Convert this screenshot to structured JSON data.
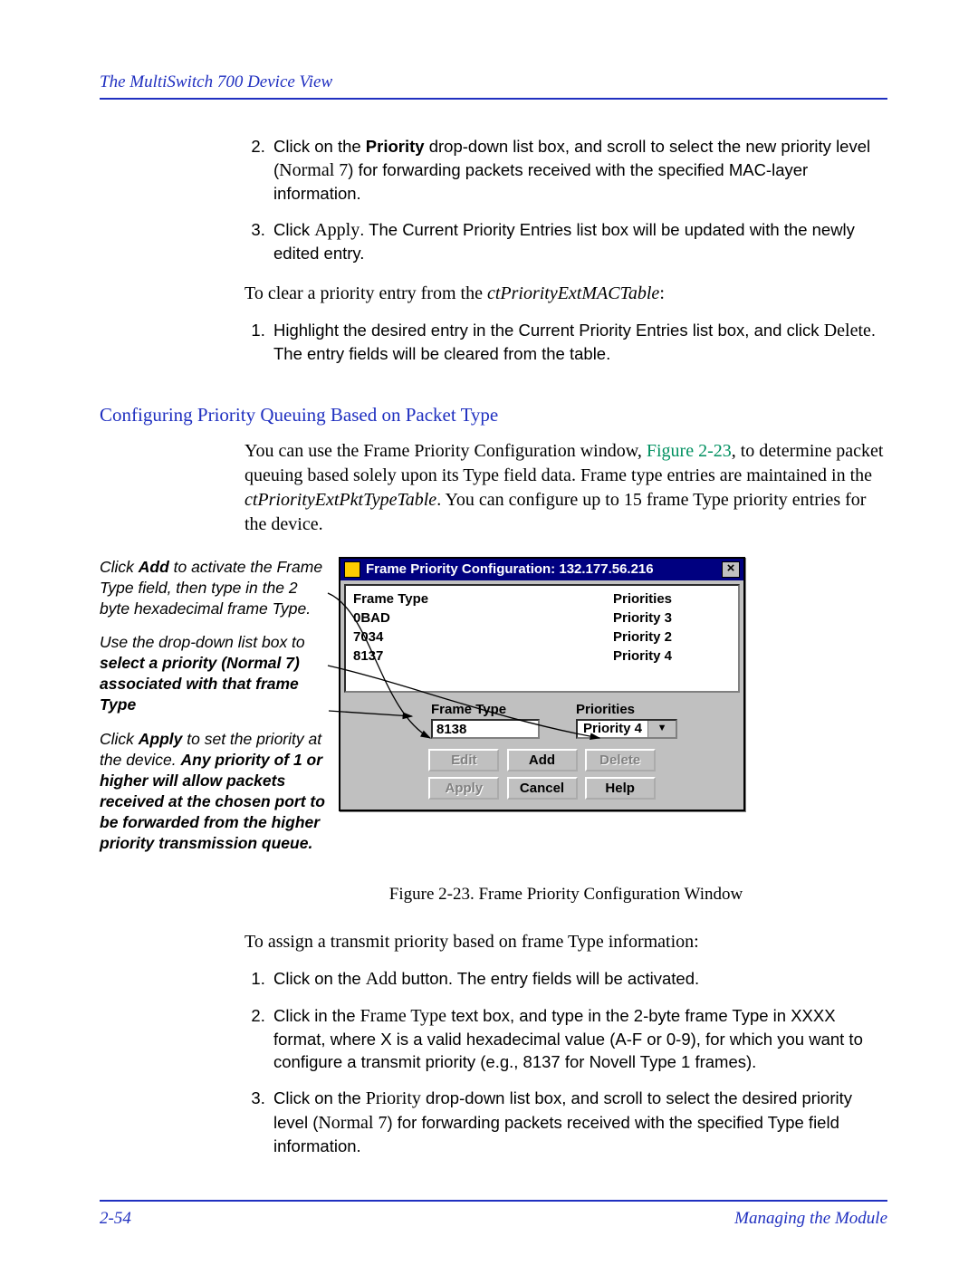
{
  "header": {
    "title": "The MultiSwitch 700 Device View"
  },
  "top_steps": {
    "step2": {
      "prefix": "Click on the ",
      "bold": "Priority",
      "mid": " drop-down list box, and scroll to select the new priority level (",
      "serif": "Normal 7",
      "suffix": ") for forwarding packets received with the specified MAC-layer information."
    },
    "step3": {
      "prefix": "Click ",
      "serif": "Apply",
      "suffix": ". The Current Priority Entries list box will be updated with the newly edited entry."
    }
  },
  "clear_intro": {
    "prefix": "To clear a priority entry from the ",
    "italic": "ctPriorityExtMACTable",
    "suffix": ":"
  },
  "clear_step1": {
    "prefix": "Highlight the desired entry in the Current Priority Entries list box, and click ",
    "serif": "Delete",
    "suffix": ". The entry fields will be cleared from the table."
  },
  "section_heading": "Configuring Priority Queuing Based on Packet Type",
  "section_intro": {
    "p1_a": "You can use the Frame Priority Configuration window, ",
    "figref": "Figure 2-23",
    "p1_b": ", to determine packet queuing based solely upon its Type field data. Frame type entries are maintained in the ",
    "italic": "ctPriorityExtPktTypeTable",
    "p1_c": ". You can configure up to 15 frame Type priority entries for the device."
  },
  "annotations": {
    "a1_p": "Click ",
    "a1_b": "Add",
    "a1_s": " to activate the Frame Type field, then type in the 2 byte hexadecimal frame Type.",
    "a2_p": "Use the drop-down list box to ",
    "a2_b": "select a priority (Normal 7) associated with that frame Type",
    "a3_p": "Click ",
    "a3_b1": "Apply",
    "a3_m": " to set the priority at the device. ",
    "a3_b2": "Any priority of 1 or higher will allow packets received at the chosen port to be forwarded from the higher priority transmission queue."
  },
  "dialog": {
    "title": "Frame Priority Configuration: 132.177.56.216",
    "headers": {
      "ft": "Frame Type",
      "pr": "Priorities"
    },
    "rows": [
      {
        "ft": "0BAD",
        "pr": "Priority 3"
      },
      {
        "ft": "7034",
        "pr": "Priority 2"
      },
      {
        "ft": "8137",
        "pr": "Priority 4"
      }
    ],
    "labels": {
      "ft": "Frame Type",
      "pr": "Priorities"
    },
    "input_value": "8138",
    "dropdown_value": "Priority 4",
    "buttons": {
      "edit": "Edit",
      "add": "Add",
      "delete": "Delete",
      "apply": "Apply",
      "cancel": "Cancel",
      "help": "Help"
    }
  },
  "caption": "Figure 2-23. Frame Priority Configuration Window",
  "assign_intro": "To assign a transmit priority based on frame Type information:",
  "assign_steps": {
    "s1_a": "Click on the ",
    "s1_serif": "Add",
    "s1_b": " button. The entry fields will be activated.",
    "s2_a": "Click in the ",
    "s2_serif": "Frame Type",
    "s2_b": " text box, and type in the 2-byte frame Type in XXXX format, where X is a valid hexadecimal value (A-F or 0-9), for which you want to configure a transmit priority (e.g., 8137 for Novell Type 1 frames).",
    "s3_a": "Click on the ",
    "s3_serif": "Priority",
    "s3_b": " drop-down list box, and scroll to select the desired priority level (",
    "s3_serif2": "Normal 7",
    "s3_c": ") for forwarding packets received with the specified Type field information."
  },
  "footer": {
    "page": "2-54",
    "section": "Managing the Module"
  }
}
